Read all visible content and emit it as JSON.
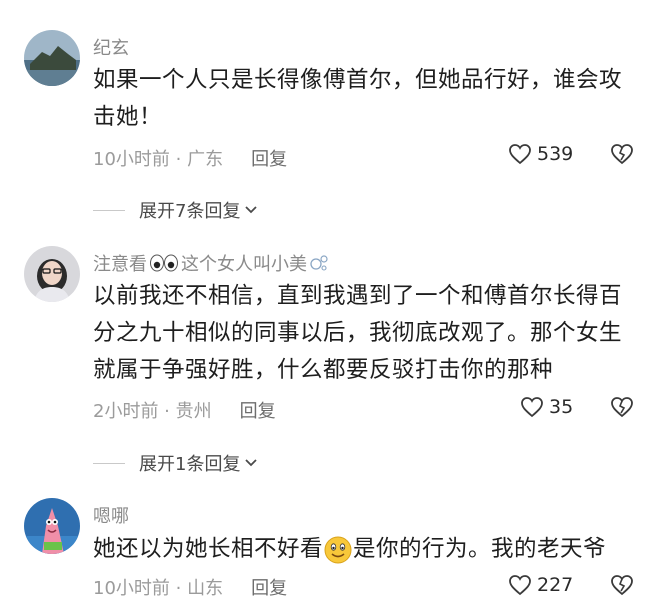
{
  "colors": {
    "meta": "#9b9b9b",
    "text": "#1e1e1e",
    "background": "#ffffff"
  },
  "comments": [
    {
      "user": "纪玄",
      "text": "如果一个人只是长得像傅首尔，但她品行好，谁会攻击她！",
      "time_location": "10小时前 · 广东",
      "reply_label": "回复",
      "likes": "539",
      "expand_label": "展开7条回复"
    },
    {
      "user": "注意看",
      "user_suffix": "这个女人叫小美",
      "text": "以前我还不相信，直到我遇到了一个和傅首尔长得百分之九十相似的同事以后，我彻底改观了。那个女生就属于争强好胜，什么都要反驳打击你的那种",
      "time_location": "2小时前 · 贵州",
      "reply_label": "回复",
      "likes": "35",
      "expand_label": "展开1条回复"
    },
    {
      "user": "嗯哪",
      "text_before": "她还以为她长相不好看",
      "text_after": "是你的行为。我的老天爷",
      "time_location": "10小时前 · 山东",
      "reply_label": "回复",
      "likes": "227"
    }
  ]
}
